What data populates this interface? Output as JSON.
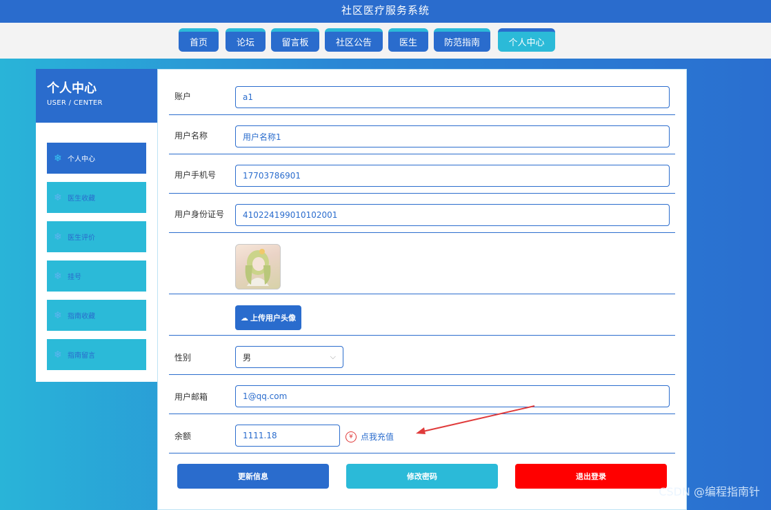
{
  "header": {
    "title": "社区医疗服务系统"
  },
  "nav": {
    "items": [
      {
        "label": "首页"
      },
      {
        "label": "论坛"
      },
      {
        "label": "留言板"
      },
      {
        "label": "社区公告"
      },
      {
        "label": "医生"
      },
      {
        "label": "防范指南"
      },
      {
        "label": "个人中心"
      }
    ]
  },
  "sidebar": {
    "title": "个人中心",
    "subtitle": "USER / CENTER",
    "items": [
      {
        "label": "个人中心"
      },
      {
        "label": "医生收藏"
      },
      {
        "label": "医生评价"
      },
      {
        "label": "挂号"
      },
      {
        "label": "指南收藏"
      },
      {
        "label": "指南留言"
      }
    ]
  },
  "form": {
    "account": {
      "label": "账户",
      "value": "a1"
    },
    "username": {
      "label": "用户名称",
      "value": "用户名称1"
    },
    "phone": {
      "label": "用户手机号",
      "value": "17703786901"
    },
    "idcard": {
      "label": "用户身份证号",
      "value": "410224199010102001"
    },
    "upload_label": "上传用户头像",
    "gender": {
      "label": "性别",
      "value": "男"
    },
    "email": {
      "label": "用户邮箱",
      "value": "1@qq.com"
    },
    "balance": {
      "label": "余额",
      "value": "1111.18",
      "recharge_label": "点我充值",
      "yen": "¥"
    }
  },
  "actions": {
    "update_label": "更新信息",
    "password_label": "修改密码",
    "logout_label": "退出登录"
  },
  "colors": {
    "primary": "#2a6ccd",
    "accent": "#2bbad8",
    "danger": "#ff0000"
  },
  "watermark": "CSDN @编程指南针"
}
